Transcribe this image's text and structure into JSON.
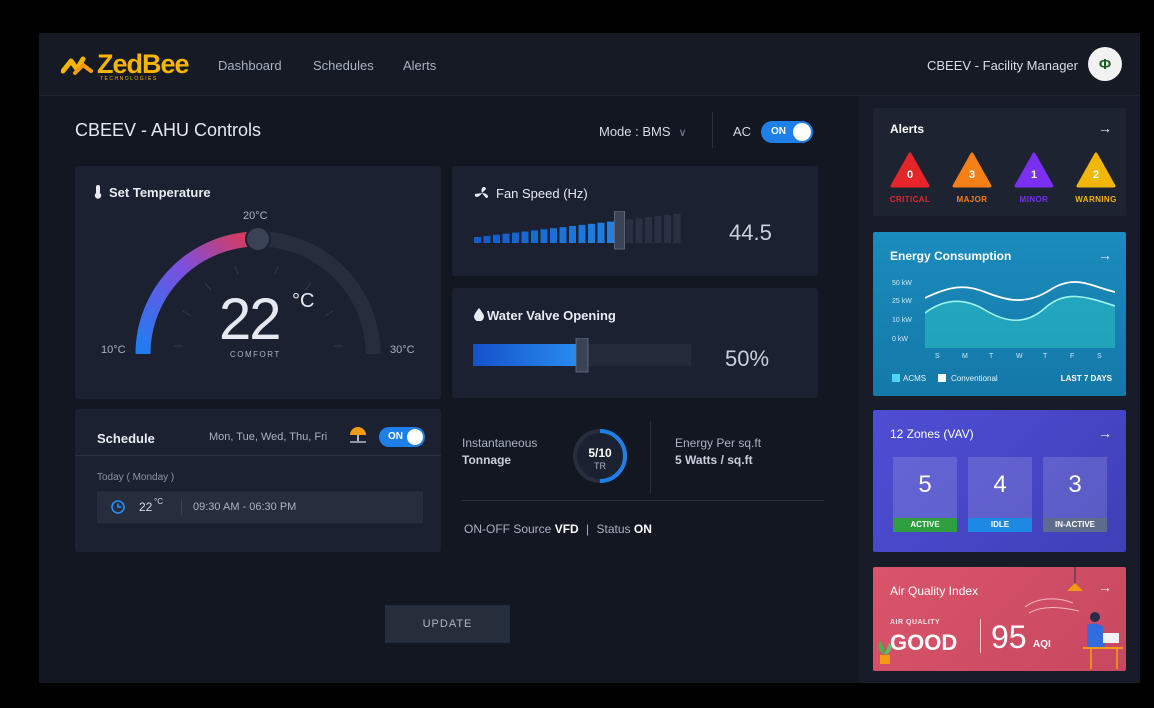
{
  "brand": {
    "name": "ZedBee",
    "sub": "TECHNOLOGIES"
  },
  "nav": [
    "Dashboard",
    "Schedules",
    "Alerts"
  ],
  "user": {
    "name": "CBEEV - Facility Manager",
    "avatar": "Φ"
  },
  "page": {
    "title": "CBEEV - AHU Controls"
  },
  "mode": {
    "label": "Mode : BMS"
  },
  "ac": {
    "label": "AC",
    "toggle": "ON"
  },
  "set_temperature": {
    "title": "Set Temperature",
    "value": "22",
    "unit": "°C",
    "status": "COMFORT",
    "min_label": "10°C",
    "mid_label": "20°C",
    "max_label": "30°C",
    "level_fraction": 0.5
  },
  "fan_speed": {
    "title": "Fan Speed (Hz)",
    "value": "44.5",
    "level_fraction": 0.7
  },
  "water_valve": {
    "title": "Water Valve Opening",
    "value": "50%",
    "level_fraction": 0.5
  },
  "schedule": {
    "title": "Schedule",
    "days": "Mon, Tue, Wed, Thu, Fri",
    "toggle": "ON",
    "today": "Today ( Monday )",
    "temp": "22",
    "temp_unit": "°C",
    "time": "09:30 AM - 06:30 PM"
  },
  "tonnage": {
    "label1": "Instantaneous",
    "label2": "Tonnage",
    "value": "5/10",
    "unit": "TR",
    "level_fraction": 0.5
  },
  "energy_per_sqft": {
    "label": "Energy Per sq.ft",
    "value": "5 Watts / sq.ft"
  },
  "source": {
    "prefix": "ON-OFF Source",
    "source_value": "VFD",
    "sep": "|",
    "status_prefix": "Status",
    "status_value": "ON"
  },
  "update_button": "UPDATE",
  "alerts": {
    "title": "Alerts",
    "items": [
      {
        "count": "0",
        "label": "CRITICAL",
        "color": "#e5252a"
      },
      {
        "count": "3",
        "label": "MAJOR",
        "color": "#f57f17"
      },
      {
        "count": "1",
        "label": "MINOR",
        "color": "#7b2ff2"
      },
      {
        "count": "2",
        "label": "WARNING",
        "color": "#f2b705"
      }
    ]
  },
  "energy_consumption": {
    "title": "Energy Consumption",
    "y_labels": [
      "50 kW",
      "25 kW",
      "10 kW",
      "0 kW"
    ],
    "x_labels": [
      "S",
      "M",
      "T",
      "W",
      "T",
      "F",
      "S"
    ],
    "legend": [
      "ACMS",
      "Conventional"
    ],
    "period": "LAST 7 DAYS"
  },
  "zones": {
    "title": "12 Zones (VAV)",
    "items": [
      {
        "count": "5",
        "label": "ACTIVE",
        "color": "#2e9e3e"
      },
      {
        "count": "4",
        "label": "IDLE",
        "color": "#1e88e5"
      },
      {
        "count": "3",
        "label": "IN-ACTIVE",
        "color": "#5f6b8a"
      }
    ]
  },
  "air_quality": {
    "title": "Air Quality Index",
    "label": "AIR QUALITY",
    "rating": "GOOD",
    "value": "95",
    "unit": "AQI"
  },
  "colors": {
    "accent_blue": "#1e7fe8",
    "brand_yellow": "#f7b500",
    "energy_card": "#1c8fb8",
    "zones_card": "#4a47c9",
    "aqi_card": "#d9556a"
  }
}
